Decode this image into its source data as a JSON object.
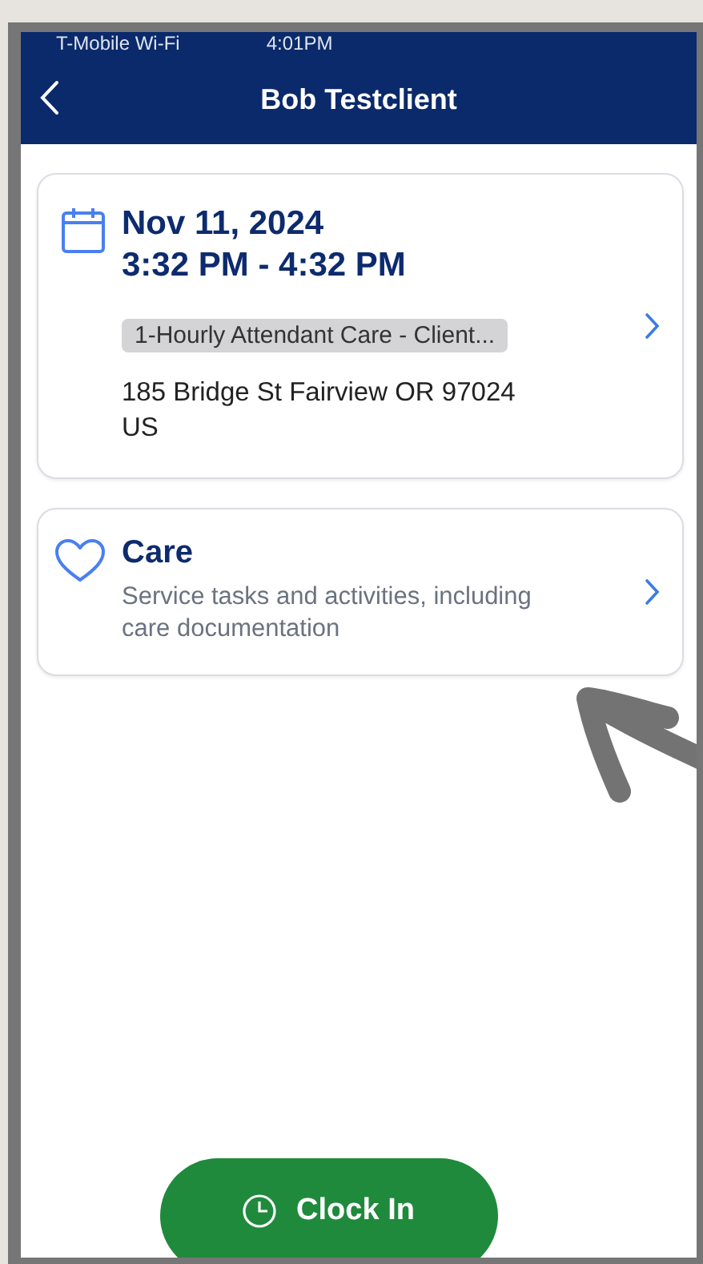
{
  "status_bar": {
    "carrier": "T-Mobile Wi-Fi",
    "time": "4:01PM"
  },
  "nav": {
    "title": "Bob Testclient"
  },
  "appointment": {
    "date": "Nov 11, 2024",
    "time_range": "3:32 PM - 4:32 PM",
    "service": "1-Hourly Attendant Care - Client...",
    "address": "185 Bridge St Fairview OR 97024 US"
  },
  "care": {
    "title": "Care",
    "description": "Service tasks and activities, including care documentation"
  },
  "clock_button": {
    "label": "Clock In"
  }
}
